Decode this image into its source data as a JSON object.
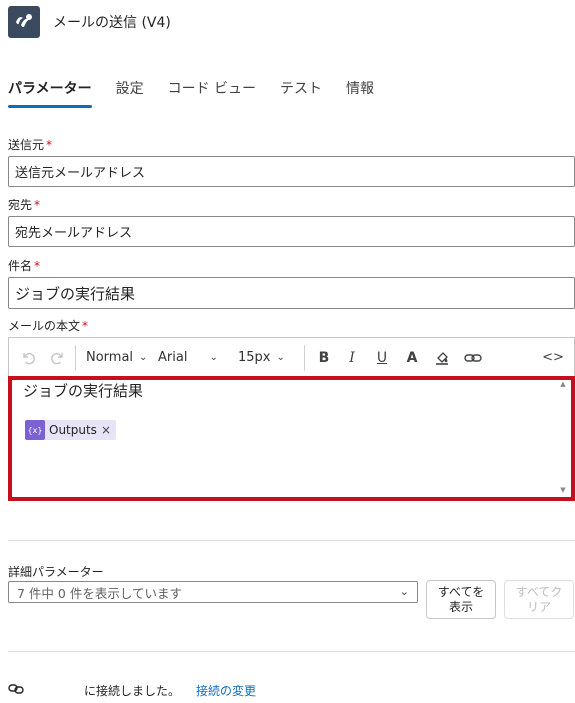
{
  "header": {
    "title": "メールの送信 (V4)",
    "icon": "sendgrid-logo-icon",
    "icon_color": "#3b4a5e"
  },
  "tabs": [
    {
      "label": "パラメーター",
      "active": true
    },
    {
      "label": "設定"
    },
    {
      "label": "コード ビュー"
    },
    {
      "label": "テスト"
    },
    {
      "label": "情報"
    }
  ],
  "fields": {
    "from": {
      "label": "送信元",
      "required_mark": "*",
      "value": "送信元メールアドレス"
    },
    "to": {
      "label": "宛先",
      "required_mark": "*",
      "value": "宛先メールアドレス"
    },
    "subject": {
      "label": "件名",
      "required_mark": "*",
      "value": "ジョブの実行結果"
    },
    "body": {
      "label": "メールの本文",
      "required_mark": "*"
    }
  },
  "editor": {
    "toolbar": {
      "paragraph": "Normal",
      "font": "Arial",
      "size": "15px"
    },
    "text": "ジョブの実行結果",
    "token": {
      "icon_text": "{x}",
      "label": "Outputs",
      "remove": "×"
    },
    "highlight_color": "#c50f1f"
  },
  "advanced": {
    "label": "詳細パラメーター",
    "select_value": "7 件中 0 件を表示しています",
    "show_all_line1": "すべてを",
    "show_all_line2": "表示",
    "clear_all_line1": "すべてク",
    "clear_all_line2": "リア"
  },
  "connection": {
    "text": "に接続しました。",
    "change_link": "接続の変更"
  },
  "colors": {
    "accent": "#0f6cbd",
    "required": "#c50f1f",
    "token_bg": "#e8e4f8",
    "token_icon": "#7b61d1"
  }
}
